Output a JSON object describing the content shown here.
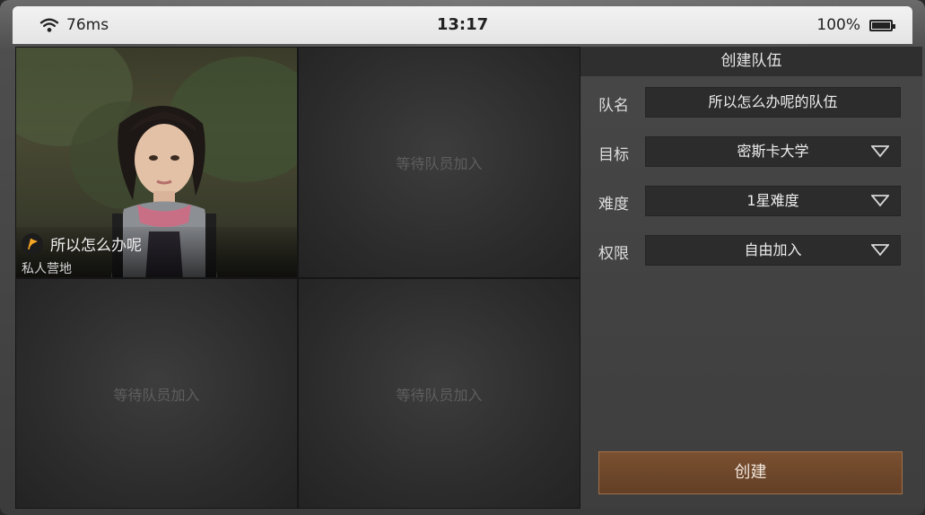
{
  "status_bar": {
    "ping": "76ms",
    "time": "13:17",
    "battery": "100%",
    "battery_level": 1.0
  },
  "slots": [
    {
      "occupied": true,
      "player_name": "所以怎么办呢",
      "camp": "私人营地"
    },
    {
      "occupied": false,
      "waiting_text": "等待队员加入"
    },
    {
      "occupied": false,
      "waiting_text": "等待队员加入"
    },
    {
      "occupied": false,
      "waiting_text": "等待队员加入"
    }
  ],
  "form": {
    "title": "创建队伍",
    "team_name": {
      "label": "队名",
      "value": "所以怎么办呢的队伍"
    },
    "target": {
      "label": "目标",
      "value": "密斯卡大学",
      "icon": "chevron-down-icon"
    },
    "difficulty": {
      "label": "难度",
      "value": "1星难度",
      "icon": "chevron-down-icon"
    },
    "permission": {
      "label": "权限",
      "value": "自由加入",
      "icon": "chevron-down-icon"
    },
    "create_label": "创建"
  },
  "colors": {
    "accent_button": "#6e4a2c",
    "leader_flag": "#f5a623"
  }
}
